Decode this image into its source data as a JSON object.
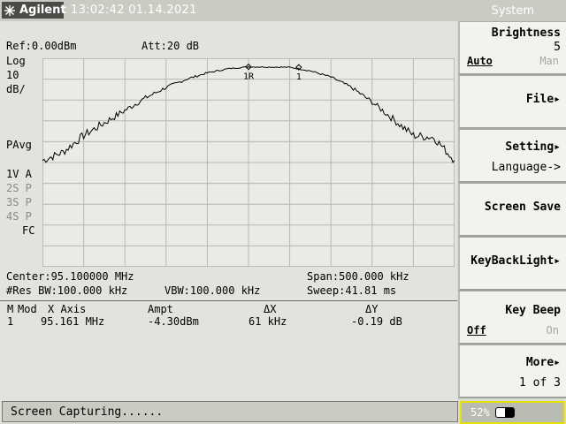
{
  "header": {
    "brand": "Agilent",
    "datetime": "13:02:42 01.14.2021",
    "menu_title": "System"
  },
  "display": {
    "ref_level": "Ref:0.00dBm",
    "attenuation": "Att:20 dB",
    "scale_type": "Log",
    "scale_value": "10",
    "scale_unit": "dB/",
    "detector": "PAvg",
    "traces": [
      {
        "label": "1V A",
        "active": true
      },
      {
        "label": "2S P",
        "active": false
      },
      {
        "label": "3S P",
        "active": false
      },
      {
        "label": "4S P",
        "active": false
      }
    ],
    "fc": "FC",
    "center": "Center:95.100000 MHz",
    "span": "Span:500.000 kHz",
    "res_bw": "#Res BW:100.000 kHz",
    "vbw": "VBW:100.000 kHz",
    "sweep": "Sweep:41.81 ms"
  },
  "marker_table": {
    "headers": [
      "M",
      "Mod",
      "X Axis",
      "Ampt",
      "ΔX",
      "ΔY"
    ],
    "rows": [
      {
        "m": "1",
        "mod": "",
        "x_axis": "95.161 MHz",
        "ampt": "-4.30dBm",
        "dx": "61 kHz",
        "dy": "-0.19 dB"
      }
    ]
  },
  "markers": {
    "ref_label": "1R",
    "delta_label": "1"
  },
  "status": "Screen Capturing......",
  "battery": {
    "percent_label": "52%",
    "level": 0.52
  },
  "softkeys": [
    {
      "title": "Brightness",
      "value": "5",
      "opt_a": "Auto",
      "opt_b": "Man"
    },
    {
      "title": "File"
    },
    {
      "title": "Setting",
      "sub": "Language->"
    },
    {
      "title": "Screen Save"
    },
    {
      "title": "KeyBackLight"
    },
    {
      "title": "Key Beep",
      "opt_a": "Off",
      "opt_b": "On"
    },
    {
      "title": "More",
      "sub": "1 of 3"
    }
  ],
  "chart_data": {
    "type": "line",
    "x_unit": "MHz",
    "y_unit": "dBm",
    "x_range": [
      94.85,
      95.35
    ],
    "ylim": [
      -100,
      0
    ],
    "grid": true,
    "x": [
      94.85,
      94.875,
      94.9,
      94.925,
      94.95,
      94.975,
      95.0,
      95.025,
      95.05,
      95.075,
      95.1,
      95.125,
      95.15,
      95.175,
      95.2,
      95.225,
      95.25,
      95.275,
      95.3,
      95.325,
      95.35
    ],
    "y": [
      -49,
      -45,
      -37,
      -31,
      -25,
      -19,
      -14,
      -10,
      -7,
      -5,
      -4.1,
      -4.2,
      -4.3,
      -6,
      -9,
      -14,
      -21,
      -29,
      -37,
      -38,
      -49
    ]
  }
}
